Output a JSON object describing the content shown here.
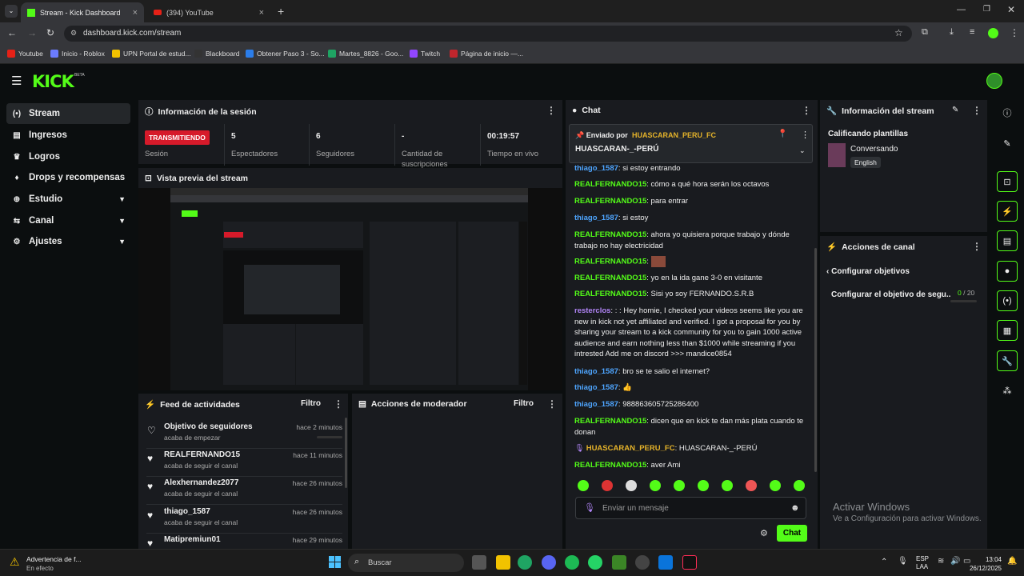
{
  "browser": {
    "tabs": [
      {
        "label": "Stream - Kick Dashboard",
        "close": "×"
      },
      {
        "label": "(394) YouTube",
        "close": "×"
      }
    ],
    "new_tab": "+",
    "url": "dashboard.kick.com/stream",
    "bookmarks": [
      "Youtube",
      "Inicio - Roblox",
      "UPN Portal de estud...",
      "Blackboard",
      "Obtener Paso 3 - So...",
      "Martes_8826 - Goo...",
      "Twitch",
      "Página de inicio —..."
    ]
  },
  "kick": {
    "logo": "KICK",
    "beta": "BETA"
  },
  "sidebar": {
    "items": [
      {
        "label": "Stream",
        "icon": "(•)"
      },
      {
        "label": "Ingresos",
        "icon": "▤"
      },
      {
        "label": "Logros",
        "icon": "♛"
      },
      {
        "label": "Drops y recompensas",
        "icon": "♦"
      },
      {
        "label": "Estudio",
        "icon": "⊕"
      },
      {
        "label": "Canal",
        "icon": "⇆"
      },
      {
        "label": "Ajustes",
        "icon": "⚙"
      }
    ]
  },
  "session": {
    "title": "Información de la sesión",
    "badge": "TRANSMITIENDO",
    "badge_label": "Sesión",
    "stats": [
      {
        "v": "5",
        "l": "Espectadores"
      },
      {
        "v": "6",
        "l": "Seguidores"
      },
      {
        "v": "-",
        "l": "Cantidad de suscripciones"
      },
      {
        "v": "00:19:57",
        "l": "Tiempo en vivo"
      }
    ]
  },
  "preview": {
    "title": "Vista previa del stream"
  },
  "feed": {
    "title": "Feed de actividades",
    "filter": "Filtro",
    "items": [
      {
        "n": "Objetivo de seguidores",
        "s": "acaba de empezar",
        "t": "hace 2 minutos",
        "icon": "♡"
      },
      {
        "n": "REALFERNANDO15",
        "s": "acaba de seguir el canal",
        "t": "hace 11 minutos",
        "icon": "♥"
      },
      {
        "n": "Alexhernandez2077",
        "s": "acaba de seguir el canal",
        "t": "hace 26 minutos",
        "icon": "♥"
      },
      {
        "n": "thiago_1587",
        "s": "acaba de seguir el canal",
        "t": "hace 26 minutos",
        "icon": "♥"
      },
      {
        "n": "Matipremiun01",
        "s": "",
        "t": "hace 29 minutos",
        "icon": "♥"
      }
    ]
  },
  "mod": {
    "title": "Acciones de moderador",
    "filter": "Filtro"
  },
  "chat": {
    "title": "Chat",
    "pinned_by": "Enviado por",
    "pinned_user": "HUASCARAN_PERU_FC",
    "pinned_msg": "HUASCARAN-_-PERÚ",
    "messages": [
      {
        "u": "thiago_1587",
        "m": ": si estoy entrando",
        "c": "b"
      },
      {
        "u": "REALFERNANDO15",
        "m": ": cómo a qué hora serán los octavos",
        "c": "g"
      },
      {
        "u": "REALFERNANDO15",
        "m": ": para entrar",
        "c": "g"
      },
      {
        "u": "thiago_1587",
        "m": ": si estoy",
        "c": "b"
      },
      {
        "u": "REALFERNANDO15",
        "m": ": ahora yo quisiera porque trabajo y dónde trabajo no hay electricidad",
        "c": "g"
      },
      {
        "u": "REALFERNANDO15",
        "m": ":",
        "c": "g"
      },
      {
        "u": "REALFERNANDO15",
        "m": ": yo en la ida gane 3-0 en visitante",
        "c": "g"
      },
      {
        "u": "REALFERNANDO15",
        "m": ": Sisi yo soy FERNANDO.S.R.B",
        "c": "g"
      },
      {
        "u": "resterclos",
        "m": ": : : Hey homie, I checked your videos seems like you are new in kick not yet affiliated and verified. I got a proposal for you by sharing your stream to a kick community for you to gain 1000 active audience and earn nothing less than $1000 while streaming if you intrested Add me on discord >>> mandice0854",
        "c": "p"
      },
      {
        "u": "thiago_1587",
        "m": ": bro se te salio el internet?",
        "c": "b"
      },
      {
        "u": "thiago_1587",
        "m": ": 👍",
        "c": "b"
      },
      {
        "u": "thiago_1587",
        "m": ": 988863605725286400",
        "c": "b"
      },
      {
        "u": "REALFERNANDO15",
        "m": ": dicen que en kick te dan más plata cuando te donan",
        "c": "g"
      },
      {
        "u": "HUASCARAN_PERU_FC",
        "m": ": HUASCARAN-_-PERÚ",
        "c": "y"
      },
      {
        "u": "REALFERNANDO15",
        "m": ": aver Ami",
        "c": "g"
      }
    ],
    "input_placeholder": "Enviar un mensaje",
    "send": "Chat"
  },
  "info": {
    "title": "Información del stream",
    "heading": "Calificando plantillas",
    "category": "Conversando",
    "lang": "English"
  },
  "actions": {
    "title": "Acciones de canal",
    "back": "Configurar objetivos",
    "goal_label": "Configurar el objetivo de segu...",
    "goal_val": "0",
    "goal_max": "/ 20"
  },
  "activate": {
    "line1": "Activar Windows",
    "line2": "Ve a Configuración para activar Windows."
  },
  "taskbar": {
    "warn_title": "Advertencia de f...",
    "warn_sub": "En efecto",
    "search": "Buscar",
    "lang1": "ESP",
    "lang2": "LAA",
    "time": "13:04",
    "date": "26/12/2025"
  },
  "colors": {
    "accent": "#53fc18",
    "live": "#d61a2a"
  }
}
